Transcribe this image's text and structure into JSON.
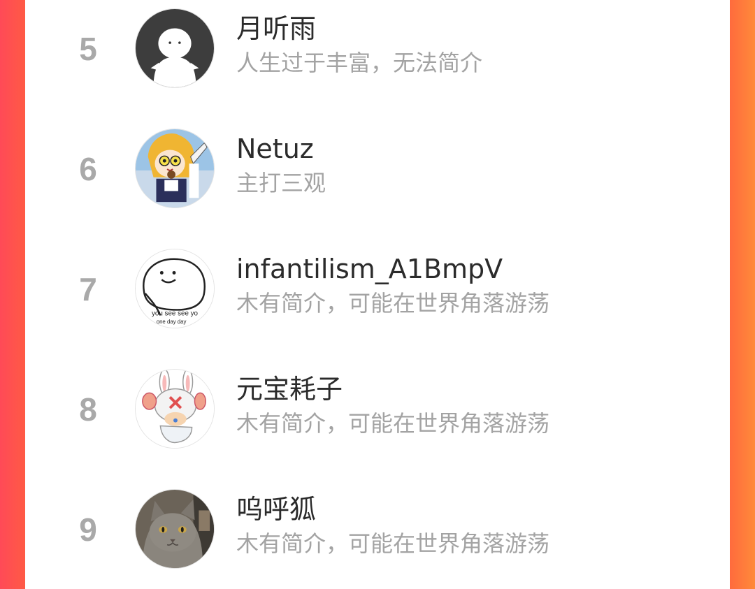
{
  "ranking": {
    "items": [
      {
        "rank": "5",
        "name": "月听雨",
        "bio": "人生过于丰富，无法简介",
        "avatar_icon": "ghost-avatar-icon"
      },
      {
        "rank": "6",
        "name": "Netuz",
        "bio": "主打三观",
        "avatar_icon": "anime-girl-avatar-icon"
      },
      {
        "rank": "7",
        "name": "infantilism_A1BmpV",
        "bio": "木有简介，可能在世界角落游荡",
        "avatar_icon": "smiley-blob-avatar-icon",
        "avatar_caption_1": "you see see yo",
        "avatar_caption_2": "one day day"
      },
      {
        "rank": "8",
        "name": "元宝耗子",
        "bio": "木有简介，可能在世界角落游荡",
        "avatar_icon": "bunny-chopper-avatar-icon"
      },
      {
        "rank": "9",
        "name": "呜呼狐",
        "bio": "木有简介，可能在世界角落游荡",
        "avatar_icon": "cat-photo-avatar-icon"
      }
    ]
  },
  "colors": {
    "background_left": "#ff4a57",
    "background_right": "#ff8a3a",
    "rank_color": "#a9a9a9",
    "name_color": "#2b2b2b",
    "bio_color": "#a3a3a3"
  }
}
